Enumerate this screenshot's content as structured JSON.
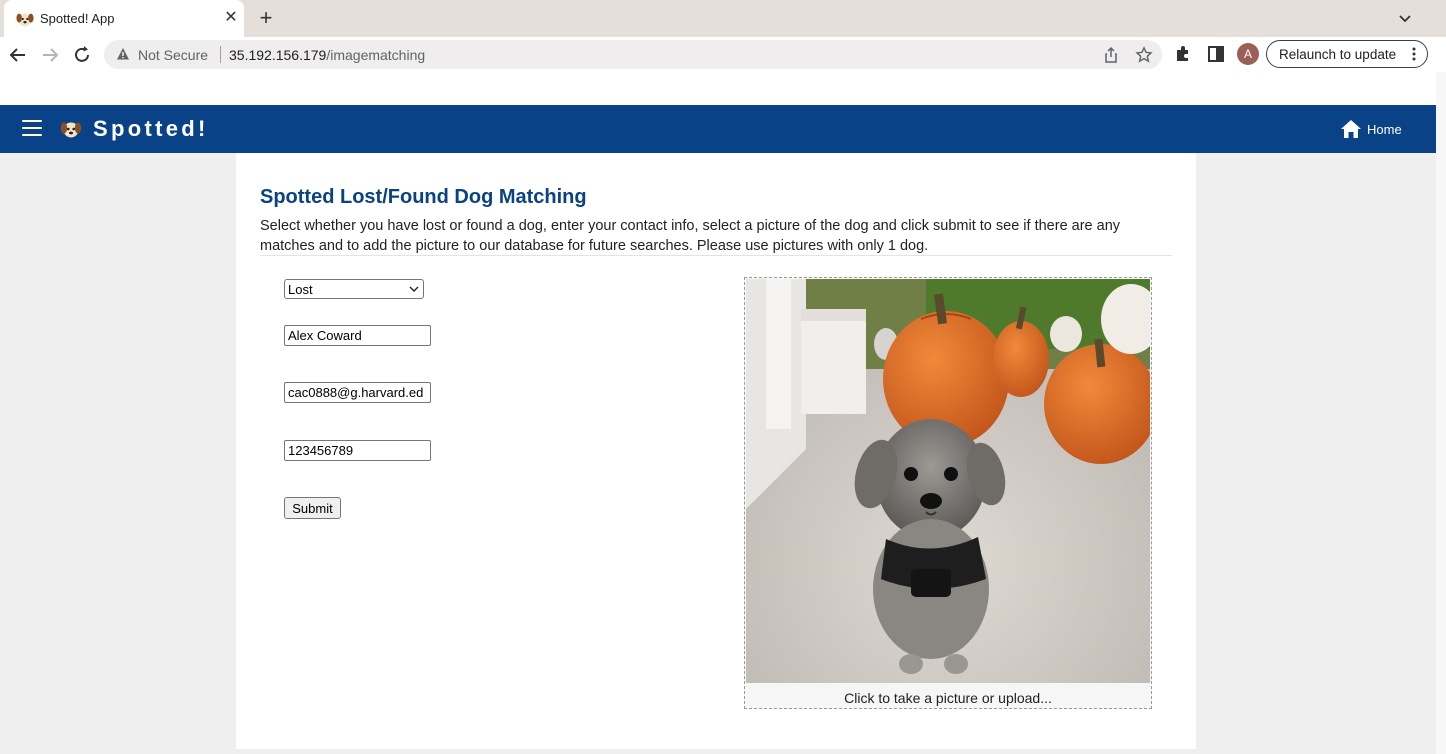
{
  "browser": {
    "tab_title": "Spotted! App",
    "security_label": "Not Secure",
    "url_host": "35.192.156.179",
    "url_path": "/imagematching",
    "profile_initial": "A",
    "relaunch_label": "Relaunch to update"
  },
  "header": {
    "app_title": "Spotted!",
    "home_label": "Home"
  },
  "form": {
    "heading": "Spotted Lost/Found Dog Matching",
    "description": "Select whether you have lost or found a dog, enter your contact info, select a picture of the dog and click submit to see if there are any matches and to add the picture to our database for future searches. Please use pictures with only 1 dog.",
    "status_selected": "Lost",
    "name_value": "Alex Coward",
    "email_value": "cac0888@g.harvard.ed",
    "phone_value": "123456789",
    "submit_label": "Submit",
    "upload_label": "Click to take a picture or upload..."
  },
  "colors": {
    "header_blue": "#0a4287",
    "page_background": "#efefef"
  }
}
